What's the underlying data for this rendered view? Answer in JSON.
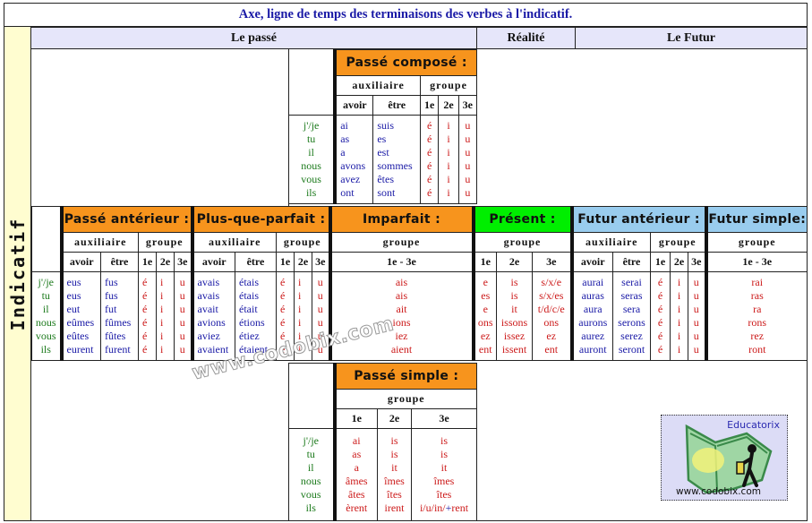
{
  "title": "Axe, ligne de temps des terminaisons des verbes à l'indicatif.",
  "side_label": "Indicatif",
  "headers": {
    "past": "Le passé",
    "present": "Réalité",
    "future": "Le Futur"
  },
  "labels": {
    "auxiliaire": "auxiliaire",
    "groupe": "groupe",
    "avoir": "avoir",
    "etre": "être",
    "g1": "1e",
    "g2": "2e",
    "g3": "3e",
    "g13": "1e - 3e"
  },
  "pronouns": [
    "j'/je",
    "tu",
    "il",
    "nous",
    "vous",
    "ils"
  ],
  "passe_compose": {
    "title": "Passé composé :",
    "avoir": [
      "ai",
      "as",
      "a",
      "avons",
      "avez",
      "ont"
    ],
    "etre": [
      "suis",
      "es",
      "est",
      "sommes",
      "êtes",
      "sont"
    ],
    "g1": [
      "é",
      "é",
      "é",
      "é",
      "é",
      "é"
    ],
    "g2": [
      "i",
      "i",
      "i",
      "i",
      "i",
      "i"
    ],
    "g3": [
      "u",
      "u",
      "u",
      "u",
      "u",
      "u"
    ]
  },
  "passe_anterieur": {
    "title": "Passé antérieur :",
    "avoir": [
      "eus",
      "eus",
      "eut",
      "eûmes",
      "eûtes",
      "eurent"
    ],
    "etre": [
      "fus",
      "fus",
      "fut",
      "fûmes",
      "fûtes",
      "furent"
    ],
    "g1": [
      "é",
      "é",
      "é",
      "é",
      "é",
      "é"
    ],
    "g2": [
      "i",
      "i",
      "i",
      "i",
      "i",
      "i"
    ],
    "g3": [
      "u",
      "u",
      "u",
      "u",
      "u",
      "u"
    ]
  },
  "plus_que_parfait": {
    "title": "Plus-que-parfait :",
    "avoir": [
      "avais",
      "avais",
      "avait",
      "avions",
      "aviez",
      "avaient"
    ],
    "etre": [
      "étais",
      "étais",
      "était",
      "étions",
      "étiez",
      "étaient"
    ],
    "g1": [
      "é",
      "é",
      "é",
      "é",
      "é",
      "é"
    ],
    "g2": [
      "i",
      "i",
      "i",
      "i",
      "i",
      "i"
    ],
    "g3": [
      "u",
      "u",
      "u",
      "u",
      "u",
      "u"
    ]
  },
  "imparfait": {
    "title": "Imparfait :",
    "g13": [
      "ais",
      "ais",
      "ait",
      "ions",
      "iez",
      "aient"
    ]
  },
  "present": {
    "title": "Présent :",
    "g1": [
      "e",
      "es",
      "e",
      "ons",
      "ez",
      "ent"
    ],
    "g2": [
      "is",
      "is",
      "it",
      "issons",
      "issez",
      "issent"
    ],
    "g3": [
      "s/x/e",
      "s/x/es",
      "t/d/c/e",
      "ons",
      "ez",
      "ent"
    ]
  },
  "futur_anterieur": {
    "title": "Futur antérieur :",
    "avoir": [
      "aurai",
      "auras",
      "aura",
      "aurons",
      "aurez",
      "auront"
    ],
    "etre": [
      "serai",
      "seras",
      "sera",
      "serons",
      "serez",
      "seront"
    ],
    "g1": [
      "é",
      "é",
      "é",
      "é",
      "é",
      "é"
    ],
    "g2": [
      "i",
      "i",
      "i",
      "i",
      "i",
      "i"
    ],
    "g3": [
      "u",
      "u",
      "u",
      "u",
      "u",
      "u"
    ]
  },
  "futur_simple": {
    "title": "Futur simple:",
    "g13": [
      "rai",
      "ras",
      "ra",
      "rons",
      "rez",
      "ront"
    ]
  },
  "passe_simple": {
    "title": "Passé simple :",
    "g1": [
      "ai",
      "as",
      "a",
      "âmes",
      "âtes",
      "èrent"
    ],
    "g2": [
      "is",
      "is",
      "it",
      "îmes",
      "îtes",
      "irent"
    ],
    "g3": [
      "is",
      "is",
      "it",
      "îmes",
      "îtes"
    ],
    "g3_last_prefix": "i/u/in/",
    "g3_last_plus": "+",
    "g3_last_suffix": "rent"
  },
  "watermark": "www.codobix.com",
  "logo": {
    "title": "Educatorix",
    "url": "www.codobix.com",
    "icon": "book-lantern-icon"
  },
  "colors": {
    "title_text": "#1a1aa6",
    "header_bg": "#e6e6fa",
    "side_bg": "#fffdd0",
    "past_tense_bg": "#f7941d",
    "present_tense_bg": "#00ee00",
    "future_tense_bg": "#99ccee",
    "pronoun_text": "#1c7a1c",
    "auxiliary_text": "#1a1aa6",
    "ending_text": "#cc1a1a"
  }
}
